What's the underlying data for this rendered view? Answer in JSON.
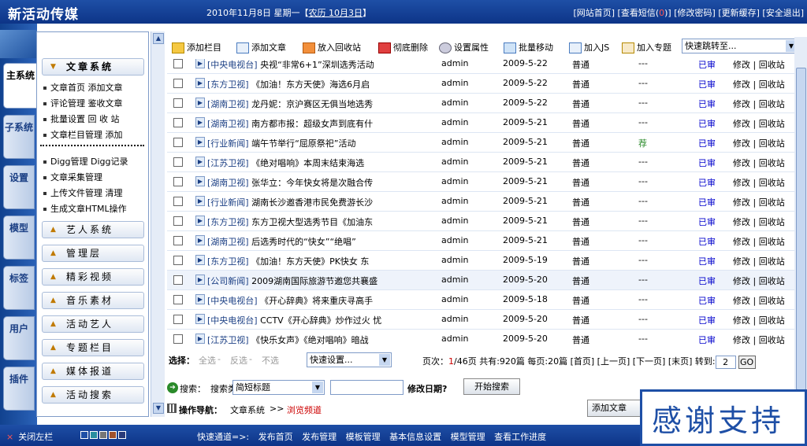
{
  "header": {
    "logo": "新活动传媒",
    "date": "2010年11月8日  星期一【",
    "lunar": "农历 10月3日",
    "date_end": "】",
    "links": [
      "[网站首页]",
      "[查看短信",
      "]",
      "[修改密码]",
      "[更新缓存]",
      "[安全退出]"
    ],
    "msg_count": "0"
  },
  "tabs": [
    "主系统",
    "子系统",
    "设置",
    "模型",
    "标签",
    "用户",
    "插件"
  ],
  "sidebar": {
    "main_section": "文章系统",
    "items": [
      "文章首页  添加文章",
      "评论管理  鉴收文章",
      "批量设置  回 收 站",
      "文章栏目管理  添加"
    ],
    "separator": "=====================",
    "items2": [
      "Digg管理  Digg记录",
      "文章采集管理",
      "上传文件管理  清理",
      "生成文章HTML操作"
    ],
    "sections": [
      "艺人系统",
      "管理层",
      "精彩视频",
      "音乐素材",
      "活动艺人",
      "专题栏目",
      "媒体报道",
      "活动搜索"
    ]
  },
  "toolbar": {
    "buttons": [
      "添加栏目",
      "添加文章",
      "放入回收站",
      "彻底删除",
      "设置属性",
      "批量移动",
      "加入JS",
      "加入专题"
    ],
    "jump_placeholder": "快速跳转至..."
  },
  "articles": [
    {
      "cat": "[中央电视台]",
      "title": " 央视“非常6+1”深圳选秀活动",
      "author": "admin",
      "date": "2009-5-22",
      "type": "普通",
      "flag": "---",
      "status": "已审"
    },
    {
      "cat": "[东方卫视]",
      "title": " 《加油！东方天使》海选6月启",
      "author": "admin",
      "date": "2009-5-22",
      "type": "普通",
      "flag": "---",
      "status": "已审"
    },
    {
      "cat": "[湖南卫视]",
      "title": " 龙丹妮：京沪赛区无俱当地选秀",
      "author": "admin",
      "date": "2009-5-22",
      "type": "普通",
      "flag": "---",
      "status": "已审"
    },
    {
      "cat": "[湖南卫视]",
      "title": " 南方都市报：超级女声到底有什",
      "author": "admin",
      "date": "2009-5-21",
      "type": "普通",
      "flag": "---",
      "status": "已审"
    },
    {
      "cat": "[行业新闻]",
      "title": " 端午节举行“屈原祭祀”活动",
      "author": "admin",
      "date": "2009-5-21",
      "type": "普通",
      "flag": "荐",
      "status": "已审"
    },
    {
      "cat": "[江苏卫视]",
      "title": " 《绝对唱响》本周末结束海选",
      "author": "admin",
      "date": "2009-5-21",
      "type": "普通",
      "flag": "---",
      "status": "已审"
    },
    {
      "cat": "[湖南卫视]",
      "title": " 张华立：今年快女将是次融合传",
      "author": "admin",
      "date": "2009-5-21",
      "type": "普通",
      "flag": "---",
      "status": "已审"
    },
    {
      "cat": "[行业新闻]",
      "title": " 湖南长沙邀香港市民免费游长沙",
      "author": "admin",
      "date": "2009-5-21",
      "type": "普通",
      "flag": "---",
      "status": "已审"
    },
    {
      "cat": "[东方卫视]",
      "title": " 东方卫视大型选秀节目《加油东",
      "author": "admin",
      "date": "2009-5-21",
      "type": "普通",
      "flag": "---",
      "status": "已审"
    },
    {
      "cat": "[湖南卫视]",
      "title": " 后选秀时代的“快女”“绝唱”",
      "author": "admin",
      "date": "2009-5-21",
      "type": "普通",
      "flag": "---",
      "status": "已审"
    },
    {
      "cat": "[东方卫视]",
      "title": " 《加油！东方天使》PK快女 东",
      "author": "admin",
      "date": "2009-5-19",
      "type": "普通",
      "flag": "---",
      "status": "已审"
    },
    {
      "cat": "[公司新闻]",
      "title": " 2009湖南国际旅游节邀您共襄盛",
      "author": "admin",
      "date": "2009-5-20",
      "type": "普通",
      "flag": "---",
      "status": "已审"
    },
    {
      "cat": "[中央电视台]",
      "title": " 《开心辞典》将来重庆寻高手",
      "author": "admin",
      "date": "2009-5-18",
      "type": "普通",
      "flag": "---",
      "status": "已审"
    },
    {
      "cat": "[中央电视台]",
      "title": " CCTV《开心辞典》炒作过火 忧",
      "author": "admin",
      "date": "2009-5-20",
      "type": "普通",
      "flag": "---",
      "status": "已审"
    },
    {
      "cat": "[江苏卫视]",
      "title": " 《快乐女声》《绝对唱响》暗战",
      "author": "admin",
      "date": "2009-5-20",
      "type": "普通",
      "flag": "---",
      "status": "已审"
    }
  ],
  "row_ops": "修改 | 回收站",
  "select_bar": {
    "label": "选择：",
    "all": "全选",
    "invert": "反选",
    "none": "不选",
    "sep": " - ",
    "quick_set": "快速设置...",
    "page_prefix": "页次：",
    "page_current": "1",
    "page_rest": "/46页  共有:920篇  每页:20篇  [首页]  [上一页]  [下一页]  [末页]  转到:",
    "goto_value": "2",
    "go": "GO"
  },
  "search": {
    "label": "搜索：",
    "type_label": "搜索类型",
    "type_value": "简短标题",
    "date_label": "修改日期?",
    "button": "开始搜索"
  },
  "nav": {
    "label": "操作导航：",
    "path1": "文章系统",
    "arrow": " >> ",
    "path2": "浏览频道"
  },
  "add_article_btn": "添加文章",
  "thanks": "感谢支持",
  "footer": {
    "close_left": "关闭左栏",
    "x": "×",
    "quick_label": "快速通道=>:",
    "links": [
      "发布首页",
      "发布管理",
      "模板管理",
      "基本信息设置",
      "模型管理",
      "查看工作进度"
    ]
  },
  "colors": {
    "primary": "#1e4fa6",
    "status": "#0000cc",
    "recommend": "#2a8a2a"
  }
}
